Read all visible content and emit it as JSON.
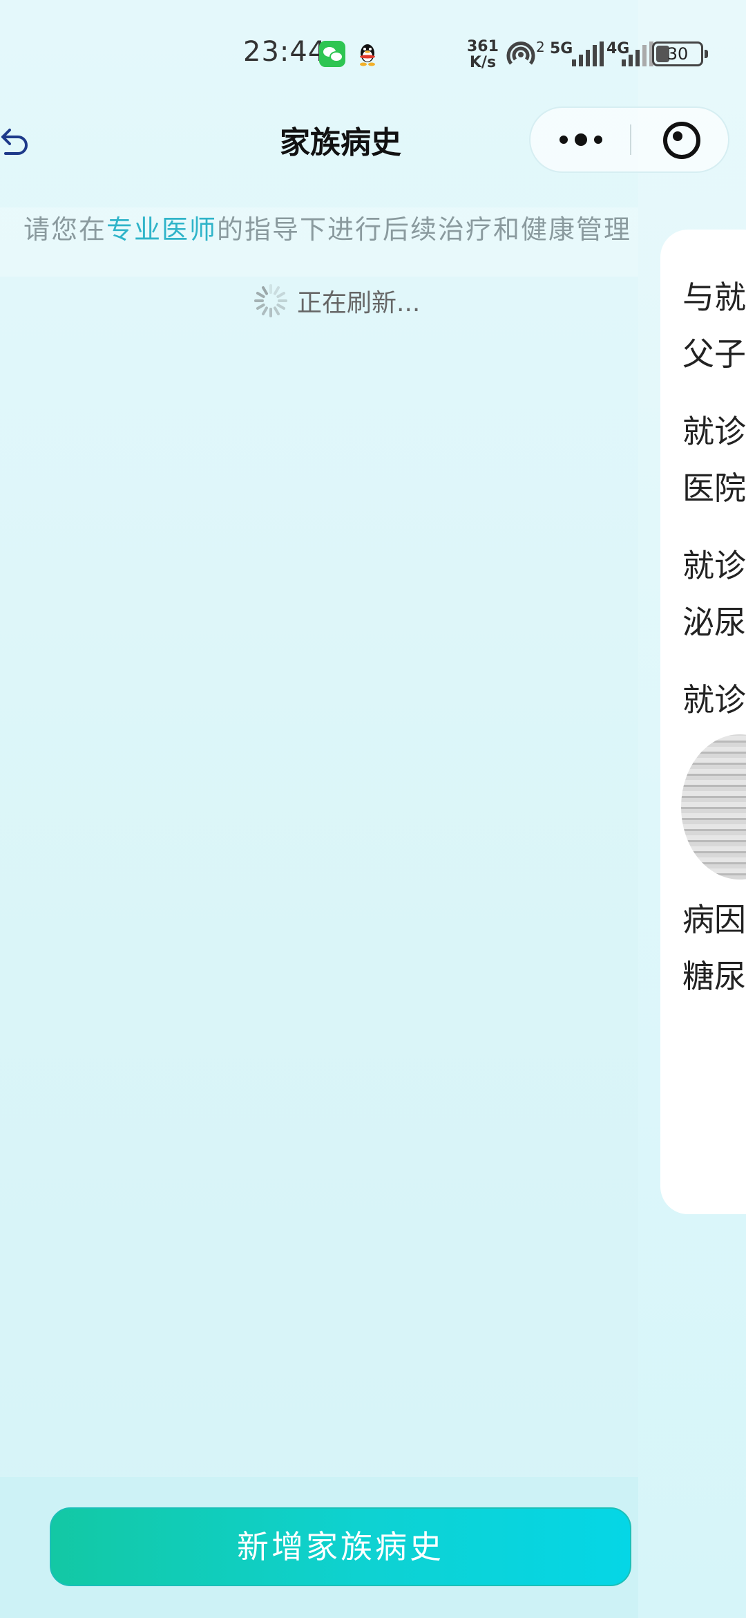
{
  "status_bar": {
    "time": "23:44",
    "net_speed_value": "361",
    "net_speed_unit": "K/s",
    "hotspot_count": "2",
    "network_1": "5G",
    "network_2": "4G",
    "battery_percent": "30",
    "battery_level": 0.3
  },
  "header": {
    "title": "家族病史"
  },
  "tip": {
    "before": "请您在",
    "highlight": "专业医师",
    "after": "的指导下进行后续治疗和健康管理"
  },
  "refresh": {
    "text": "正在刷新..."
  },
  "side_card": {
    "lines": [
      "与就",
      "父子",
      "就诊",
      "医院",
      "就诊",
      "泌尿",
      "就诊",
      "病因",
      "糖尿"
    ]
  },
  "footer": {
    "add_label": "新增家族病史"
  },
  "colors": {
    "accent": "#2fb4c9",
    "button_start": "#13c8a4",
    "button_end": "#05d6e6"
  }
}
